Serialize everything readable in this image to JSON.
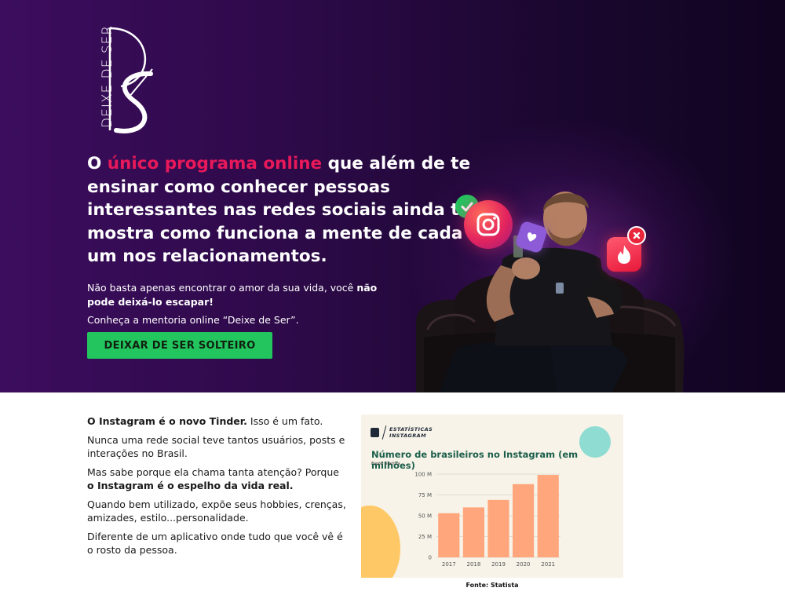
{
  "logo": {
    "text": "DEIXE DE SER"
  },
  "hero": {
    "headline_prefix": "O ",
    "headline_highlight": "único programa online",
    "headline_rest": " que além de te ensinar como conhecer pessoas interessantes nas redes sociais ainda te mostra como funciona a mente de cada um nos relacionamentos.",
    "sub1_text": "Não basta apenas encontrar o amor da sua vida, você ",
    "sub1_bold": "não pode deixá-lo escapar!",
    "sub2": "Conheça a mentoria online “Deixe de Ser”.",
    "cta_label": "DEIXAR DE SER SOLTEIRO",
    "colors": {
      "highlight": "#e8185a",
      "cta": "#22c55e"
    },
    "icons": [
      "check-icon",
      "instagram-icon",
      "heart-icon",
      "tinder-flame-icon",
      "close-icon"
    ]
  },
  "content": {
    "p1_bold": "O Instagram é o novo Tinder.",
    "p1_rest": " Isso é um fato.",
    "p2": "Nunca uma rede social teve tantos usuários, posts e interações no Brasil.",
    "p3_text": "Mas sabe porque ela chama tanta atenção? Porque ",
    "p3_bold": "o Instagram é o espelho da vida real.",
    "p4": "Quando bem utilizado, expõe seus hobbies, crenças, amizades, estilo...personalidade.",
    "p5": "Diferente de um aplicativo onde tudo que você vê é o rosto da pessoa."
  },
  "stats_card": {
    "brand_line1": "ESTATÍSTICAS",
    "brand_line2": "INSTAGRAM",
    "source_small": "Fonte: Statista",
    "caption": "Fonte: Statista"
  },
  "chart_data": {
    "type": "bar",
    "title": "Número de brasileiros no Instagram (em milhões)",
    "categories": [
      "2017",
      "2018",
      "2019",
      "2020",
      "2021"
    ],
    "values": [
      53,
      60,
      69,
      88,
      99
    ],
    "ylim": [
      0,
      100
    ],
    "yticks": [
      0,
      25,
      50,
      75,
      100
    ],
    "ytick_labels": [
      "0",
      "25 M",
      "50 M",
      "75 M",
      "100 M"
    ],
    "bar_color": "#ffa67c",
    "grid": true
  }
}
